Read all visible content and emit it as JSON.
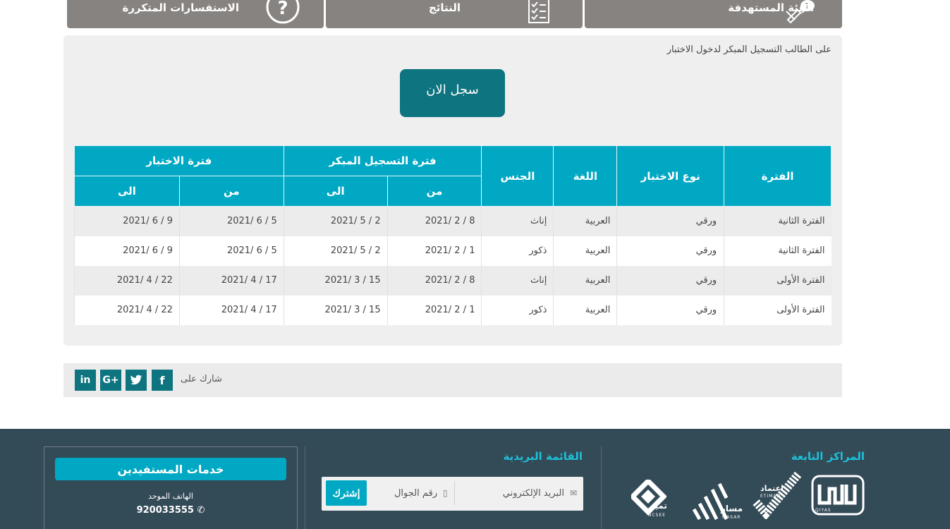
{
  "tabs": [
    {
      "label": "الفئة المستهدفة",
      "icon": "target-audience-icon"
    },
    {
      "label": "النتائج",
      "icon": "checklist-icon"
    },
    {
      "label": "الاستفسارات المتكررة",
      "icon": "question-icon"
    }
  ],
  "notice": "على الطالب التسجيل المبكر لدخول الاختبار",
  "register_button": "سجل الان",
  "table": {
    "headers": {
      "period": "الفترة",
      "test_type": "نوع الاختبار",
      "language": "اللغة",
      "gender": "الجنس",
      "early_registration": "فترة التسجيل المبكر",
      "test_period": "فترة الاختبار",
      "from": "من",
      "to": "الى"
    },
    "rows": [
      {
        "period": "الفترة الثانية",
        "type": "ورقي",
        "lang": "العربية",
        "gender": "إناث",
        "reg_from": "2021/ 2 / 8",
        "reg_to": "2021/ 5 / 2",
        "test_from": "2021/ 6 / 5",
        "test_to": "2021/ 6 / 9"
      },
      {
        "period": "الفترة الثانية",
        "type": "ورقي",
        "lang": "العربية",
        "gender": "ذكور",
        "reg_from": "2021/ 2 / 1",
        "reg_to": "2021/ 5 / 2",
        "test_from": "2021/ 6 / 5",
        "test_to": "2021/ 6 / 9"
      },
      {
        "period": "الفترة الأولى",
        "type": "ورقي",
        "lang": "العربية",
        "gender": "إناث",
        "reg_from": "2021/ 2 / 8",
        "reg_to": "2021/ 3 / 15",
        "test_from": "2021/ 4 / 17",
        "test_to": "2021/ 4 / 22"
      },
      {
        "period": "الفترة الأولى",
        "type": "ورقي",
        "lang": "العربية",
        "gender": "ذكور",
        "reg_from": "2021/ 2 / 1",
        "reg_to": "2021/ 3 / 15",
        "test_from": "2021/ 4 / 17",
        "test_to": "2021/ 4 / 22"
      }
    ]
  },
  "share": {
    "label": "شارك على",
    "networks": [
      {
        "name": "facebook",
        "glyph": "f"
      },
      {
        "name": "twitter",
        "glyph": "t"
      },
      {
        "name": "google-plus",
        "glyph": "G+"
      },
      {
        "name": "linkedin",
        "glyph": "in"
      }
    ]
  },
  "footer": {
    "centers_title": "المراكز التابعة",
    "mailing_title": "القائمة البريدية",
    "email_placeholder": "البريد الإلكتروني",
    "mobile_placeholder": "رقم الجوال",
    "subscribe_button": "إشترك",
    "services_title": "خدمات المستفيدين",
    "unified_phone_label": "الهاتف الموحد",
    "unified_phone": "920033555",
    "logos": {
      "qiyas": {
        "name": "قياس",
        "sub": "QIYAS"
      },
      "etimad": {
        "name": "اعتماد",
        "sub": "ETIMAD"
      },
      "masar": {
        "name": "مسار",
        "sub": "MASAR"
      },
      "tamayuz": {
        "name": "تميز",
        "sub": "NCSEE"
      }
    }
  },
  "colors": {
    "accent": "#00a8c3",
    "dark_teal": "#0e7580",
    "tab_gray": "#878380",
    "footer_bg": "#334a57"
  }
}
